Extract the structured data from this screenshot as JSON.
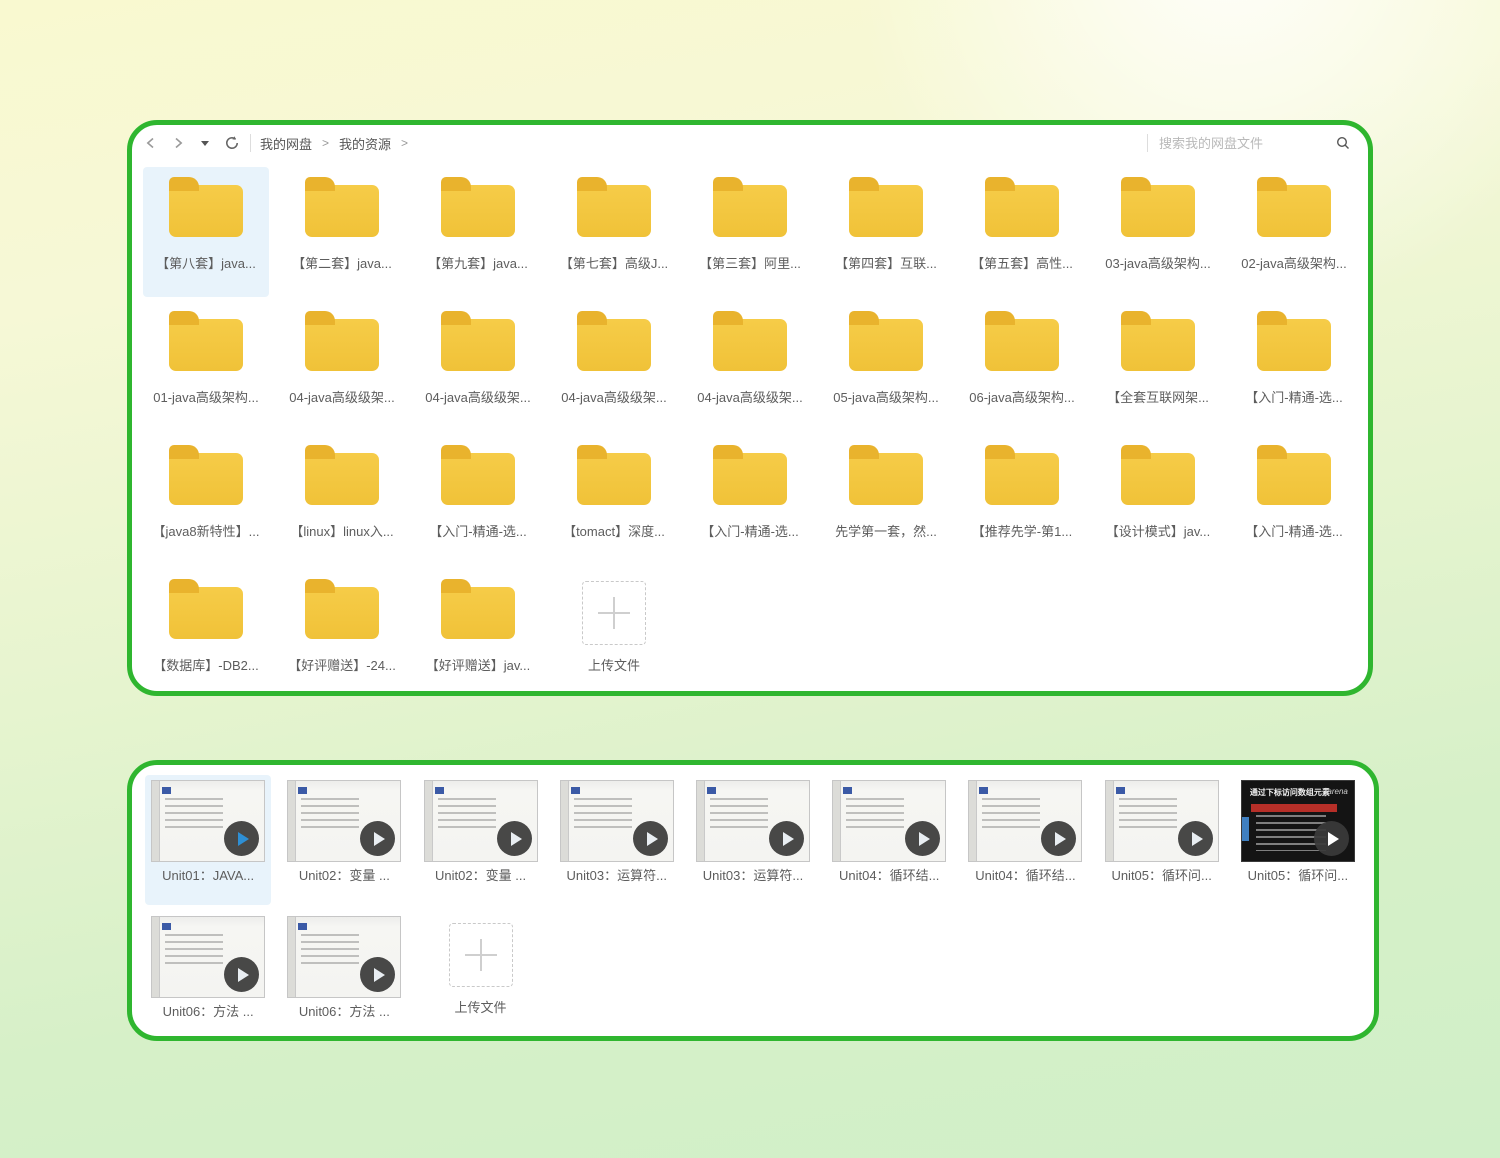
{
  "colors": {
    "panel_border": "#2fb62f",
    "folder_body": "#f0c238",
    "folder_tab": "#e9b32d",
    "selected_tile_bg": "#e8f3fb",
    "background_top": "#f9f9d0",
    "background_bottom": "#d0efc8",
    "play_triangle_blue": "#2e8fd4"
  },
  "file_panel": {
    "toolbar": {
      "breadcrumb": [
        {
          "label": "我的网盘"
        },
        {
          "label": "我的资源"
        }
      ],
      "separator": ">",
      "search_placeholder": "搜索我的网盘文件"
    },
    "folders": [
      {
        "label": "【第八套】java...",
        "selected": true
      },
      {
        "label": "【第二套】java..."
      },
      {
        "label": "【第九套】java..."
      },
      {
        "label": "【第七套】高级J..."
      },
      {
        "label": "【第三套】阿里..."
      },
      {
        "label": "【第四套】互联..."
      },
      {
        "label": "【第五套】高性..."
      },
      {
        "label": "03-java高级架构..."
      },
      {
        "label": "02-java高级架构..."
      },
      {
        "label": "01-java高级架构..."
      },
      {
        "label": "04-java高级级架..."
      },
      {
        "label": "04-java高级级架..."
      },
      {
        "label": "04-java高级级架..."
      },
      {
        "label": "04-java高级级架..."
      },
      {
        "label": "05-java高级架构..."
      },
      {
        "label": "06-java高级架构..."
      },
      {
        "label": "【全套互联网架..."
      },
      {
        "label": "【入门-精通-选..."
      },
      {
        "label": "【java8新特性】..."
      },
      {
        "label": "【linux】linux入..."
      },
      {
        "label": "【入门-精通-选..."
      },
      {
        "label": "【tomact】深度..."
      },
      {
        "label": "【入门-精通-选..."
      },
      {
        "label": "先学第一套，然..."
      },
      {
        "label": "【推荐先学-第1..."
      },
      {
        "label": "【设计模式】jav..."
      },
      {
        "label": "【入门-精通-选..."
      },
      {
        "label": "【数据库】-DB2..."
      },
      {
        "label": "【好评赠送】-24..."
      },
      {
        "label": "【好评赠送】jav..."
      }
    ],
    "upload_label": "上传文件"
  },
  "video_panel": {
    "videos": [
      {
        "label": "Unit01：JAVA...",
        "selected": true
      },
      {
        "label": "Unit02：变量 ..."
      },
      {
        "label": "Unit02：变量 ..."
      },
      {
        "label": "Unit03：运算符..."
      },
      {
        "label": "Unit03：运算符..."
      },
      {
        "label": "Unit04：循环结..."
      },
      {
        "label": "Unit04：循环结..."
      },
      {
        "label": "Unit05：循环问..."
      },
      {
        "label": "Unit05：循环问...",
        "dark": true,
        "thumb_title": "通过下标访问数组元素",
        "watermark": "Tarena"
      },
      {
        "label": "Unit06：方法 ..."
      },
      {
        "label": "Unit06：方法 ..."
      }
    ],
    "upload_label": "上传文件"
  }
}
